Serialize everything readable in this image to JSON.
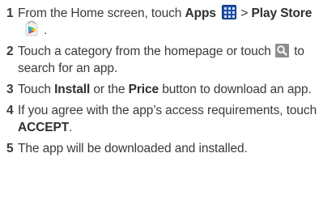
{
  "steps": [
    {
      "num": "1",
      "t1": "From the Home screen, touch ",
      "b1": "Apps",
      "t2": " > ",
      "b2": "Play Store",
      "t3": "."
    },
    {
      "num": "2",
      "t1": "Touch a category from the homepage or touch ",
      "t2": " to search for an app."
    },
    {
      "num": "3",
      "t1": "Touch ",
      "b1": "Install",
      "t2": " or the ",
      "b2": "Price",
      "t3": " button to download an app."
    },
    {
      "num": "4",
      "t1": "If you agree with the app’s access requirements, touch ",
      "b1": "ACCEPT",
      "t2": "."
    },
    {
      "num": "5",
      "t1": "The app will be downloaded and installed."
    }
  ],
  "icons": {
    "apps": "apps-grid-icon",
    "play_store": "play-store-icon",
    "search": "search-icon"
  },
  "colors": {
    "text": "#3a3a3a",
    "apps_icon": "#1f4fa6",
    "search_icon_bg": "#8d8d8d"
  }
}
